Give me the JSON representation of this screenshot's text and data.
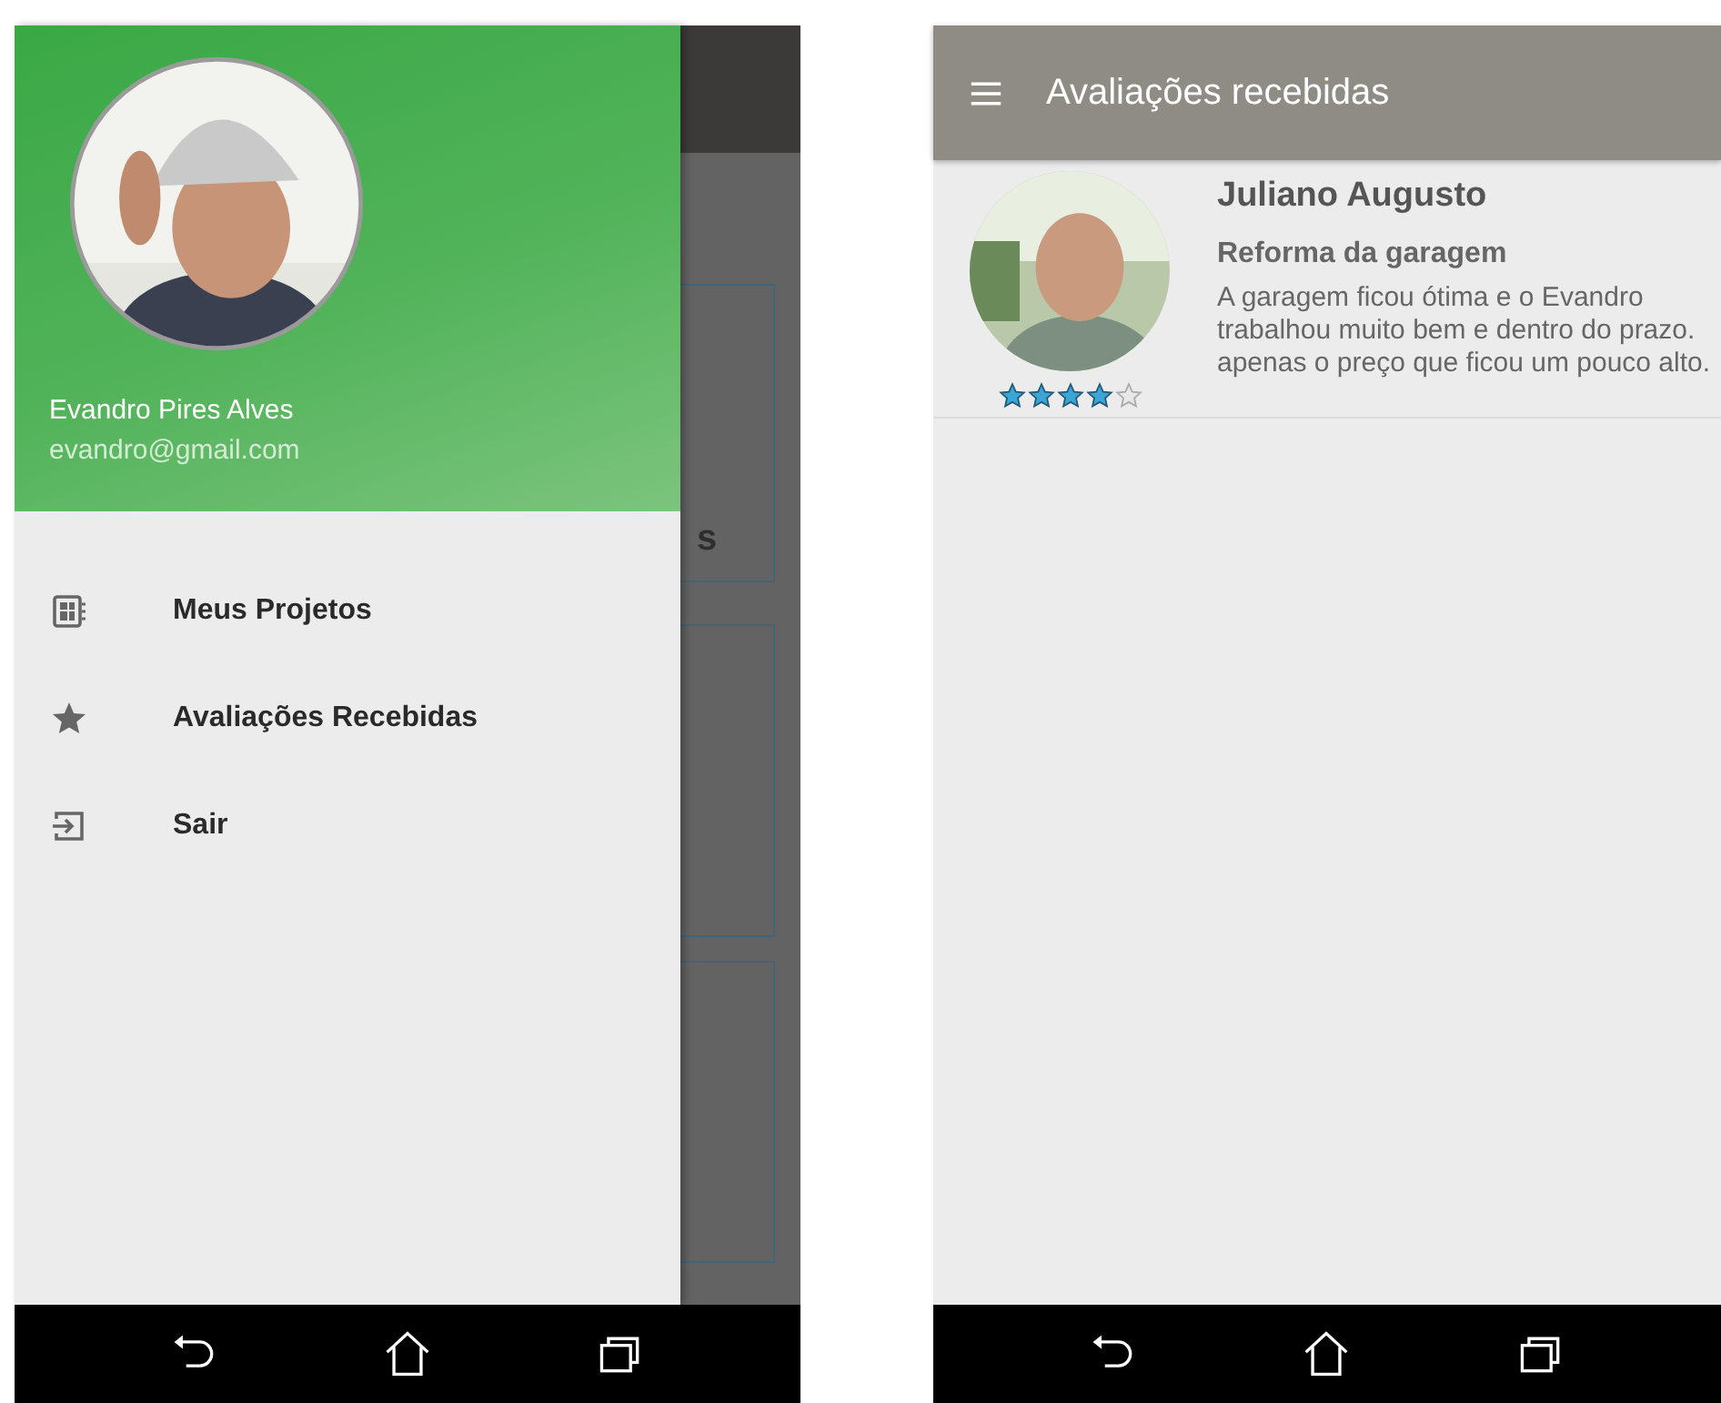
{
  "drawer_screen": {
    "profile": {
      "name": "Evandro Pires Alves",
      "email": "evandro@gmail.com"
    },
    "menu_items": [
      {
        "kind": "projects",
        "label": "Meus Projetos"
      },
      {
        "kind": "star",
        "label": "Avaliações Recebidas"
      },
      {
        "kind": "exit",
        "label": "Sair"
      }
    ],
    "background_text": "s"
  },
  "reviews_screen": {
    "title": "Avaliações recebidas",
    "reviews": [
      {
        "reviewer": "Juliano Augusto",
        "project": "Reforma da garagem",
        "stars": 4,
        "comment": "A garagem ficou ótima e o Evandro trabalhou muito bem e dentro do prazo. apenas o preço que ficou um pouco alto."
      }
    ]
  }
}
